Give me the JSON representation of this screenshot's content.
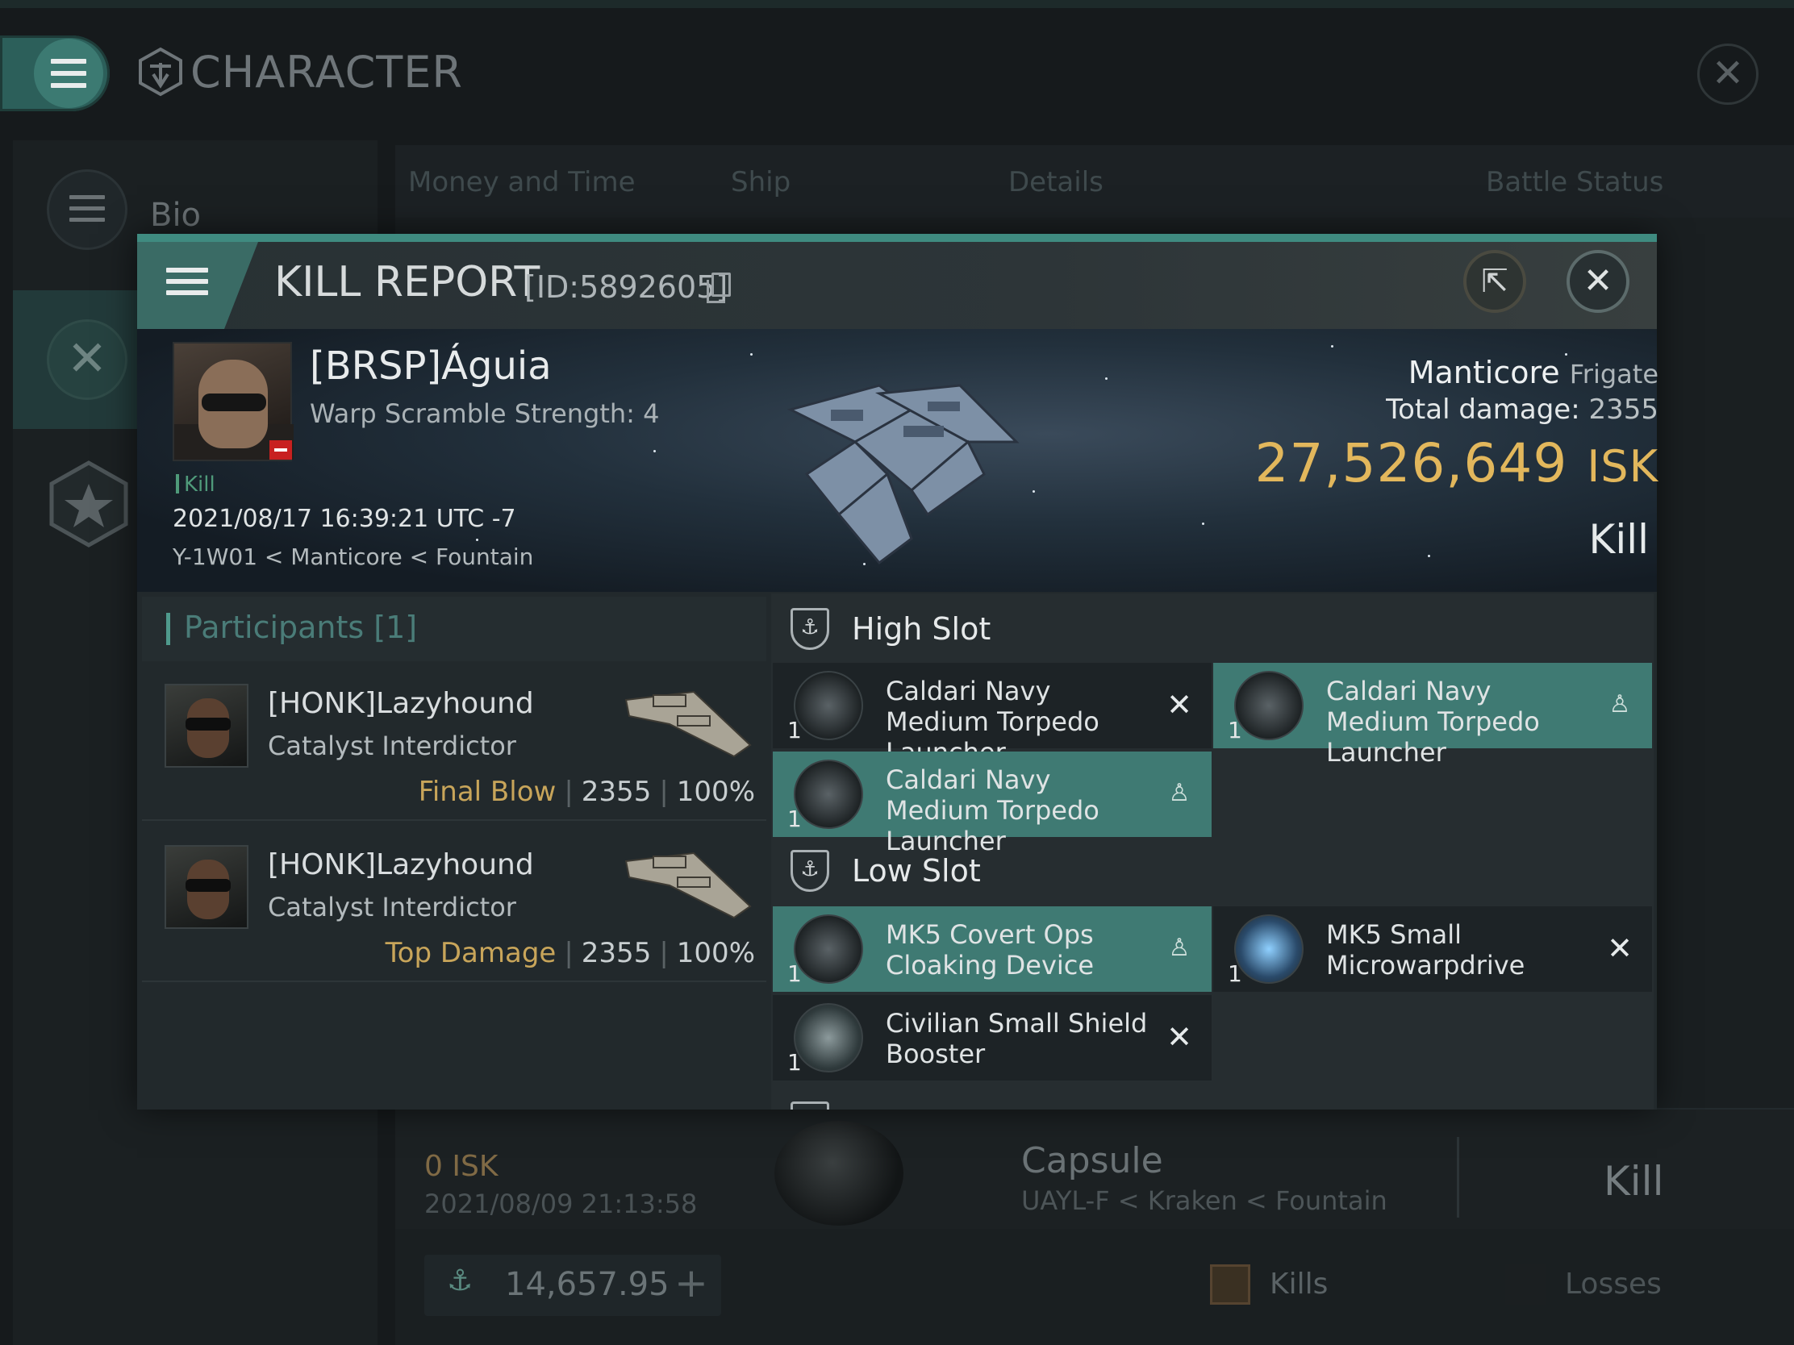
{
  "app": {
    "title": "CHARACTER",
    "sidebar": [
      {
        "label": "Bio",
        "icon": "list-icon"
      },
      {
        "label": "",
        "icon": "crossed-swords-icon"
      },
      {
        "label": "",
        "icon": "star-medal-icon"
      }
    ],
    "tabs": [
      "Money and Time",
      "Ship",
      "Details",
      "Battle Status"
    ]
  },
  "background_kill": {
    "isk": "0  ISK",
    "date": "2021/08/09  21:13:58",
    "ship": "Capsule",
    "location": "UAYL-F < Kraken < Fountain",
    "status": "Kill"
  },
  "footer": {
    "balance": "14,657.95",
    "kills_label": "Kills",
    "losses_label": "Losses",
    "kills_color": "#564430"
  },
  "kill_report": {
    "title": "KILL REPORT",
    "id": "[ID:5892605]",
    "victim": {
      "name": "[BRSP]Águia",
      "scramble": "Warp Scramble Strength: 4",
      "tag": "Kill",
      "datetime": "2021/08/17 16:39:21 UTC -7",
      "location": "Y-1W01 < Manticore < Fountain"
    },
    "ship": {
      "name": "Manticore",
      "class": "Frigate",
      "total_damage_label": "Total damage:",
      "total_damage": "2355",
      "isk_value": "27,526,649",
      "isk_unit": "ISK",
      "result": "Kill"
    },
    "participants_title": "Participants [1]",
    "participants": [
      {
        "name": "[HONK]Lazyhound",
        "ship": "Catalyst Interdictor",
        "label": "Final Blow",
        "damage": "2355",
        "percent": "100%"
      },
      {
        "name": "[HONK]Lazyhound",
        "ship": "Catalyst Interdictor",
        "label": "Top Damage",
        "damage": "2355",
        "percent": "100%"
      }
    ],
    "slots": {
      "high": {
        "label": "High Slot",
        "items": [
          {
            "qty": "1",
            "name": "Caldari Navy Medium Torpedo Launcher",
            "status": "destroyed"
          },
          {
            "qty": "1",
            "name": "Caldari Navy Medium Torpedo Launcher",
            "status": "dropped"
          },
          {
            "qty": "1",
            "name": "Caldari Navy Medium Torpedo Launcher",
            "status": "dropped"
          }
        ]
      },
      "low": {
        "label": "Low Slot",
        "items": [
          {
            "qty": "1",
            "name": "MK5 Covert Ops Cloaking Device",
            "status": "dropped"
          },
          {
            "qty": "1",
            "name": "MK5 Small Microwarpdrive",
            "status": "destroyed"
          },
          {
            "qty": "1",
            "name": "Civilian Small Shield Booster",
            "status": "destroyed"
          }
        ]
      }
    },
    "colors": {
      "accent": "#3f8b80",
      "isk": "#e2b75c",
      "fitted": "#3f7a73",
      "label": "#c8a55a"
    }
  }
}
